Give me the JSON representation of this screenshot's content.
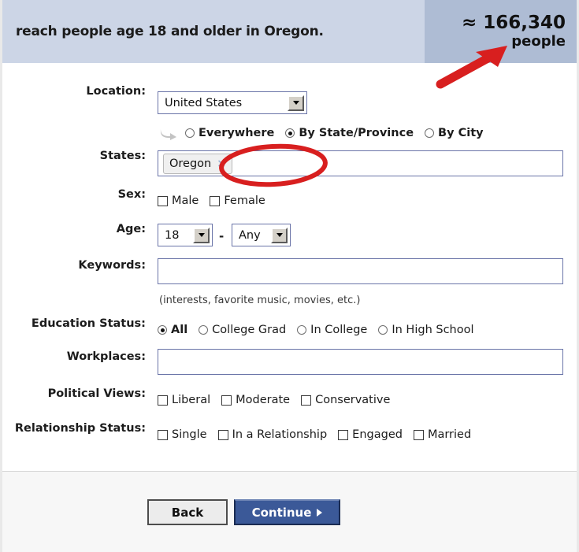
{
  "header": {
    "reach_text": "reach people age 18 and older in Oregon.",
    "estimate_approx": "≈ 166,340",
    "estimate_unit": "people",
    "bg_left": "#ccd5e6",
    "bg_right": "#aebcd4"
  },
  "form": {
    "location": {
      "label": "Location:",
      "selected": "United States",
      "scope_options": [
        {
          "label": "Everywhere",
          "selected": false
        },
        {
          "label": "By State/Province",
          "selected": true
        },
        {
          "label": "By City",
          "selected": false
        }
      ]
    },
    "states": {
      "label": "States:",
      "tokens": [
        {
          "text": "Oregon",
          "remove": "×"
        }
      ],
      "value": ""
    },
    "sex": {
      "label": "Sex:",
      "options": [
        {
          "label": "Male",
          "checked": false
        },
        {
          "label": "Female",
          "checked": false
        }
      ]
    },
    "age": {
      "label": "Age:",
      "min": "18",
      "separator": "-",
      "max": "Any"
    },
    "keywords": {
      "label": "Keywords:",
      "value": "",
      "placeholder": "",
      "hint": "(interests, favorite music, movies, etc.)"
    },
    "education": {
      "label": "Education Status:",
      "options": [
        {
          "label": "All",
          "selected": true
        },
        {
          "label": "College Grad",
          "selected": false
        },
        {
          "label": "In College",
          "selected": false
        },
        {
          "label": "In High School",
          "selected": false
        }
      ]
    },
    "workplaces": {
      "label": "Workplaces:",
      "value": "",
      "placeholder": ""
    },
    "political": {
      "label": "Political Views:",
      "options": [
        {
          "label": "Liberal",
          "checked": false
        },
        {
          "label": "Moderate",
          "checked": false
        },
        {
          "label": "Conservative",
          "checked": false
        }
      ]
    },
    "relationship": {
      "label": "Relationship Status:",
      "options": [
        {
          "label": "Single",
          "checked": false
        },
        {
          "label": "In a Relationship",
          "checked": false
        },
        {
          "label": "Engaged",
          "checked": false
        },
        {
          "label": "Married",
          "checked": false
        }
      ]
    }
  },
  "footer": {
    "back_label": "Back",
    "continue_label": "Continue"
  },
  "annotations": {
    "color": "#d81f1f",
    "arrow": "red-arrow-pointing-to-estimate",
    "ellipse": "red-ellipse-around-oregon-token"
  }
}
